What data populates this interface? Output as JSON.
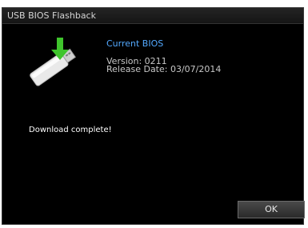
{
  "window": {
    "title": "USB BIOS Flashback"
  },
  "bios": {
    "heading": "Current BIOS",
    "version_line": "Version:  0211",
    "release_line": "Release Date:  03/07/2014"
  },
  "status": {
    "message": "Download complete!"
  },
  "buttons": {
    "ok_label": "OK"
  },
  "icons": {
    "usb": "usb-drive-download-icon"
  },
  "colors": {
    "heading": "#53a9ff",
    "arrow": "#3fc52c",
    "background": "#000000"
  }
}
